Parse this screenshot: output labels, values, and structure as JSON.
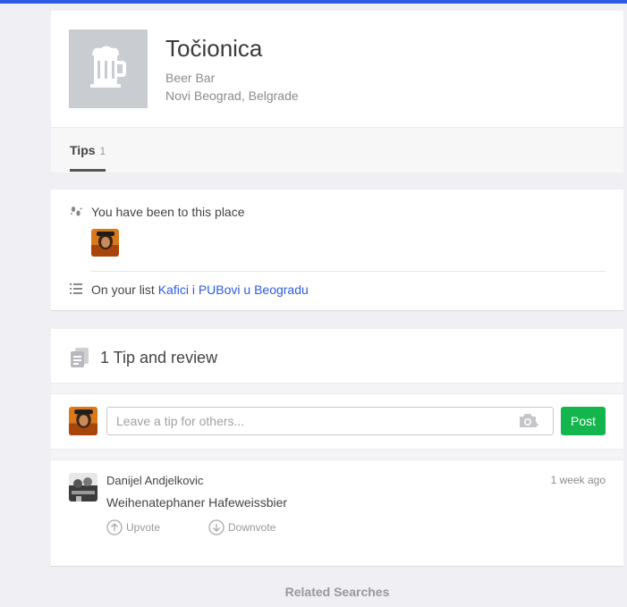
{
  "venue": {
    "name": "Točionica",
    "category": "Beer Bar",
    "location": "Novi Beograd, Belgrade",
    "photo_icon": "beer-mug-icon"
  },
  "tabs": [
    {
      "label": "Tips",
      "count": "1",
      "active": true
    }
  ],
  "visited": {
    "text": "You have been to this place",
    "icon": "footsteps-icon"
  },
  "lists": {
    "prefix": "On your list",
    "link_label": "Kafici i PUBovi u Beogradu",
    "icon": "list-icon"
  },
  "tips": {
    "title": "1 Tip and review",
    "icon": "documents-icon",
    "composer": {
      "placeholder": "Leave a tip for others...",
      "post_label": "Post",
      "camera_icon": "camera-add-icon"
    },
    "items": [
      {
        "author": "Danijel Andjelkovic",
        "time": "1 week ago",
        "text": "Weihenatephaner Hafeweissbier",
        "upvote_label": "Upvote",
        "downvote_label": "Downvote"
      }
    ]
  },
  "related": {
    "label": "Related Searches"
  },
  "colors": {
    "accent": "#2d5be3",
    "post_button": "#13b54d",
    "page_bg": "#efeff4"
  }
}
